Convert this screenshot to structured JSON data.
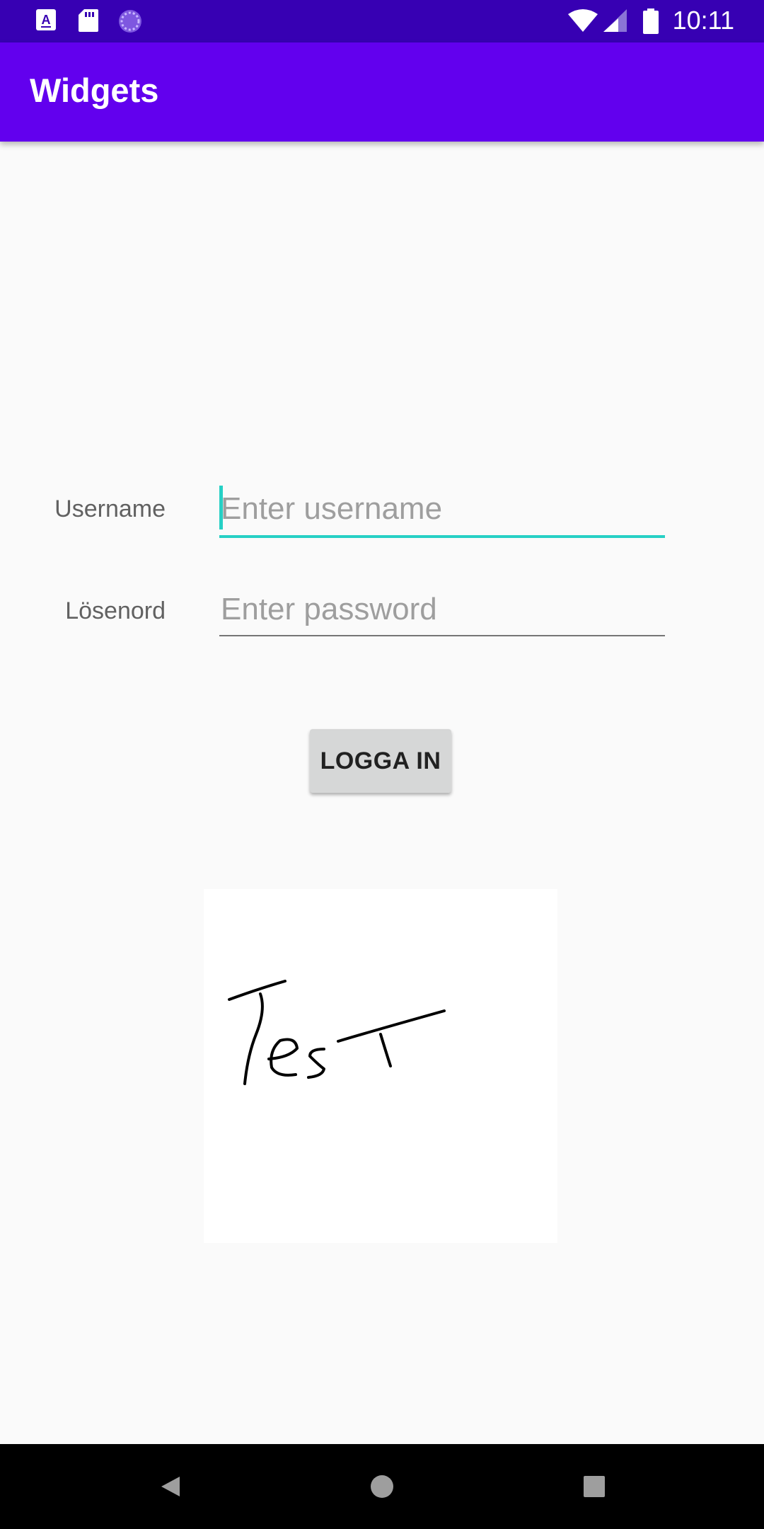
{
  "status_bar": {
    "time": "10:11",
    "icons": [
      "font-notification-icon",
      "sd-card-icon",
      "sync-icon",
      "wifi-icon",
      "cellular-signal-icon",
      "battery-icon"
    ]
  },
  "app_bar": {
    "title": "Widgets"
  },
  "form": {
    "username": {
      "label": "Username",
      "placeholder": "Enter username",
      "value": ""
    },
    "password": {
      "label": "Lösenord",
      "placeholder": "Enter password",
      "value": ""
    },
    "login_button_label": "LOGGA IN"
  },
  "signature": {
    "handwritten_text": "Test"
  },
  "colors": {
    "status_bar": "#3700b3",
    "app_bar": "#6200ee",
    "focus_accent": "#26d0c5",
    "background": "#fafafa"
  },
  "nav_bar": {
    "buttons": [
      "back-icon",
      "home-icon",
      "recents-icon"
    ]
  }
}
